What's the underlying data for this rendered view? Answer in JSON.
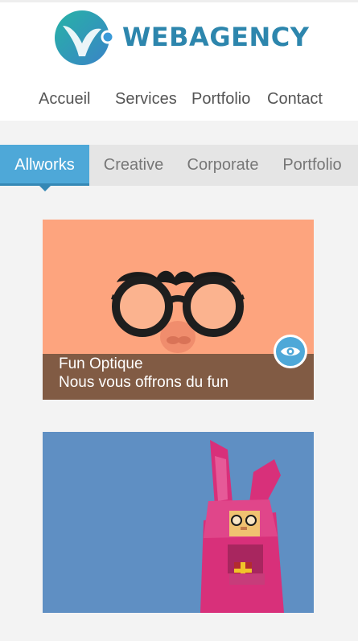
{
  "brand": {
    "name": "WEBAGENCY"
  },
  "nav": {
    "items": [
      {
        "label": "Accueil"
      },
      {
        "label": "Services"
      },
      {
        "label": "Portfolio"
      },
      {
        "label": "Contact"
      }
    ]
  },
  "filters": {
    "active": "Allworks",
    "items": [
      {
        "label": "Allworks"
      },
      {
        "label": "Creative"
      },
      {
        "label": "Corporate"
      },
      {
        "label": "Portfolio"
      }
    ]
  },
  "portfolio": {
    "cards": [
      {
        "title": "Fun Optique",
        "subtitle": "Nous vous offrons du fun",
        "icon": "eye-icon"
      },
      {
        "illustration": "pink-rabbit-costume-illustration"
      }
    ]
  },
  "colors": {
    "accent": "#4ea8d8",
    "brand": "#2d86ad",
    "card1_bg": "#fda47e",
    "card2_bg": "#5f8fc3",
    "caption_bg": "#815b44"
  }
}
